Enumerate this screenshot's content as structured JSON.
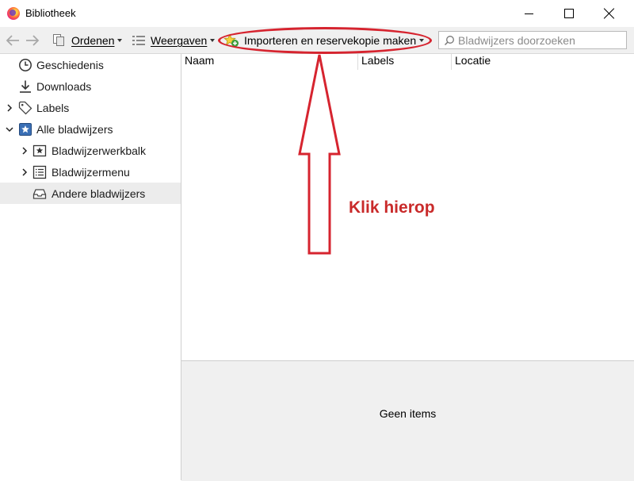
{
  "window": {
    "title": "Bibliotheek"
  },
  "toolbar": {
    "organize_label": "Ordenen",
    "views_label": "Weergaven",
    "import_label": "Importeren en reservekopie maken",
    "search_placeholder": "Bladwijzers doorzoeken"
  },
  "sidebar": {
    "items": [
      {
        "label": "Geschiedenis",
        "icon": "clock-icon"
      },
      {
        "label": "Downloads",
        "icon": "download-icon"
      },
      {
        "label": "Labels",
        "icon": "tag-icon"
      },
      {
        "label": "Alle bladwijzers",
        "icon": "bookmarks-star-icon"
      },
      {
        "label": "Bladwijzerwerkbalk",
        "icon": "bookmark-toolbar-icon"
      },
      {
        "label": "Bladwijzermenu",
        "icon": "bookmark-menu-icon"
      },
      {
        "label": "Andere bladwijzers",
        "icon": "inbox-tray-icon"
      }
    ],
    "selected": "Andere bladwijzers"
  },
  "columns": [
    "Naam",
    "Labels",
    "Locatie"
  ],
  "details": {
    "empty_text": "Geen items"
  },
  "annotation": {
    "text": "Klik hierop",
    "color": "#d6242f"
  }
}
